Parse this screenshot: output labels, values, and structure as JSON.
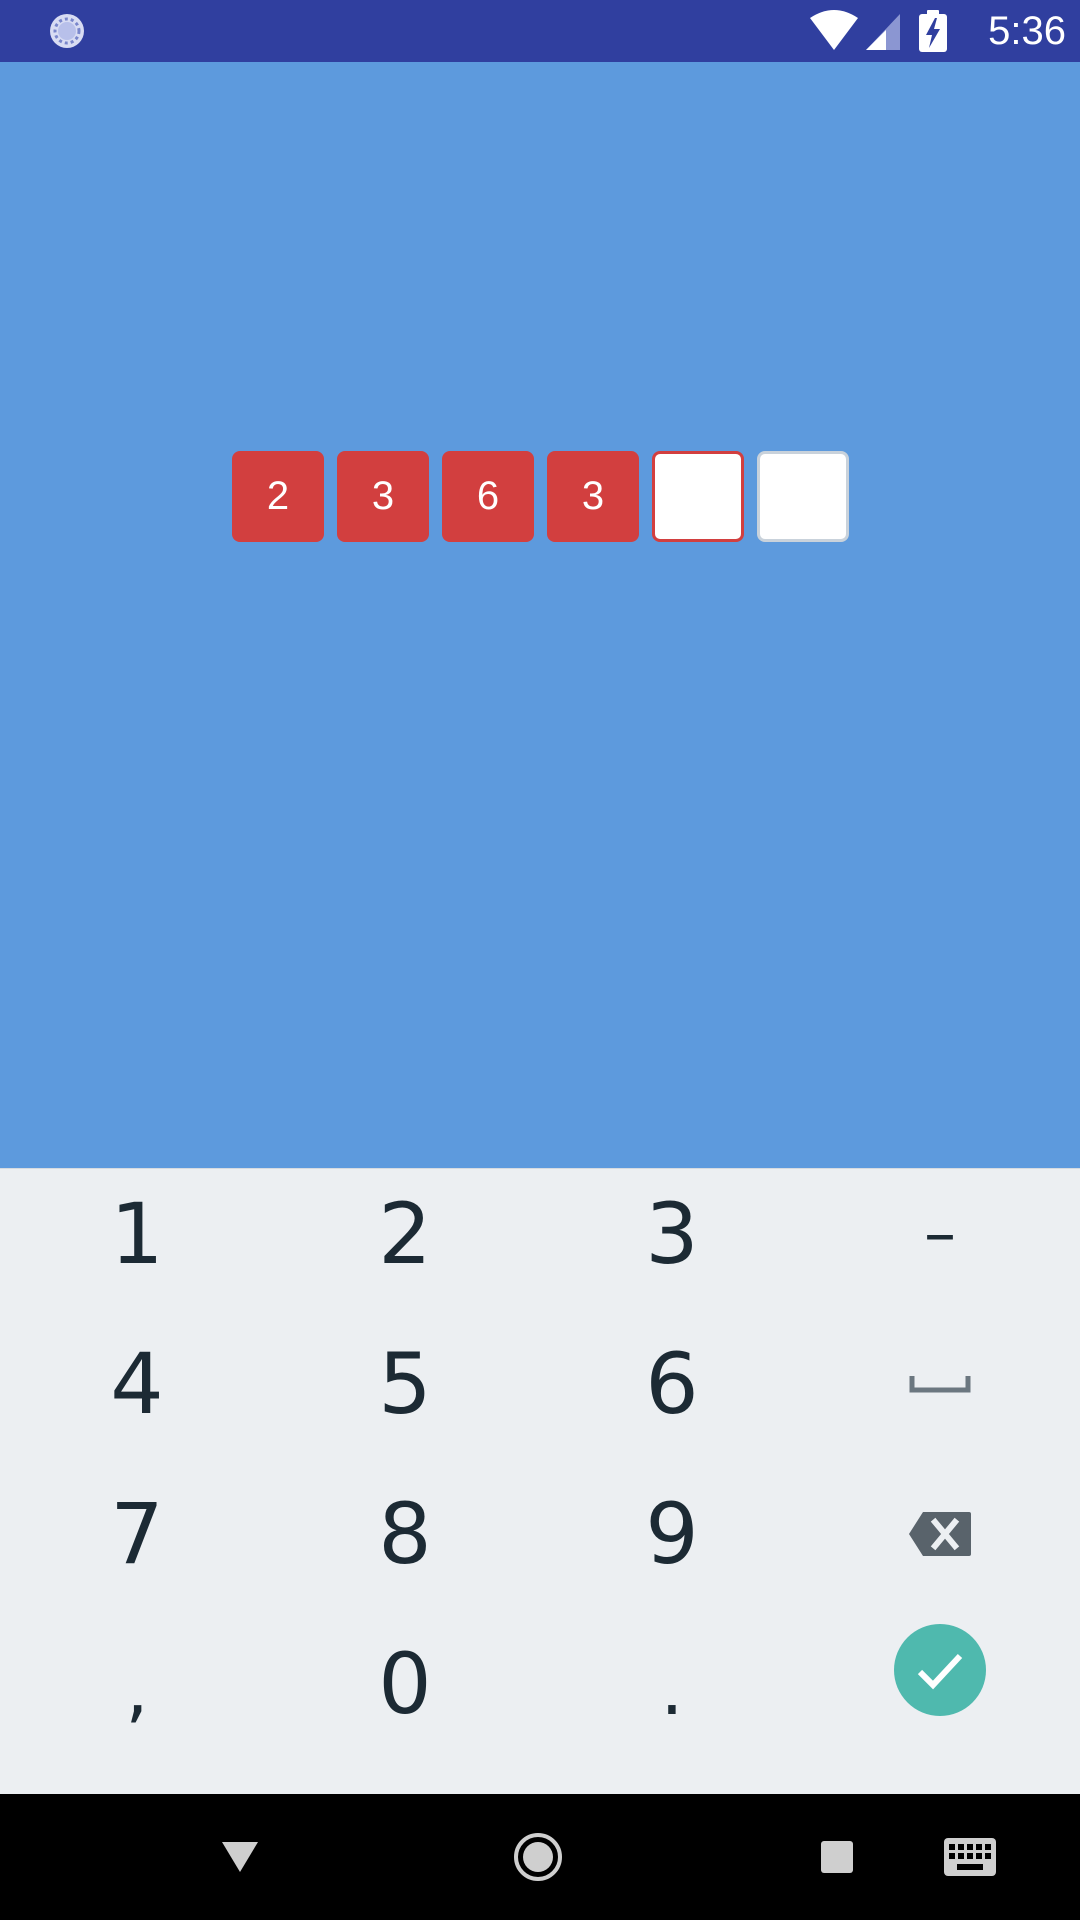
{
  "status_bar": {
    "time": "5:36",
    "icons": [
      "loader-icon",
      "wifi-icon",
      "signal-icon",
      "battery-charging-icon"
    ],
    "background": "#303f9f"
  },
  "pin_entry": {
    "digits": [
      "2",
      "3",
      "6",
      "3",
      "",
      ""
    ],
    "filled_color": "#d23f3f",
    "background": "#5d9add"
  },
  "keyboard": {
    "rows": [
      [
        "1",
        "2",
        "3",
        "-"
      ],
      [
        "4",
        "5",
        "6",
        "space-icon"
      ],
      [
        "7",
        "8",
        "9",
        "backspace-icon"
      ],
      [
        ",",
        "0",
        ".",
        "done-check-icon"
      ]
    ],
    "keys": {
      "k1": "1",
      "k2": "2",
      "k3": "3",
      "minus": "–",
      "k4": "4",
      "k5": "5",
      "k6": "6",
      "k7": "7",
      "k8": "8",
      "k9": "9",
      "comma": ",",
      "k0": "0",
      "period": "."
    },
    "accent": "#4fb9ae"
  },
  "nav_bar": {
    "buttons": [
      "back-icon",
      "home-icon",
      "recents-icon",
      "keyboard-switch-icon"
    ]
  }
}
